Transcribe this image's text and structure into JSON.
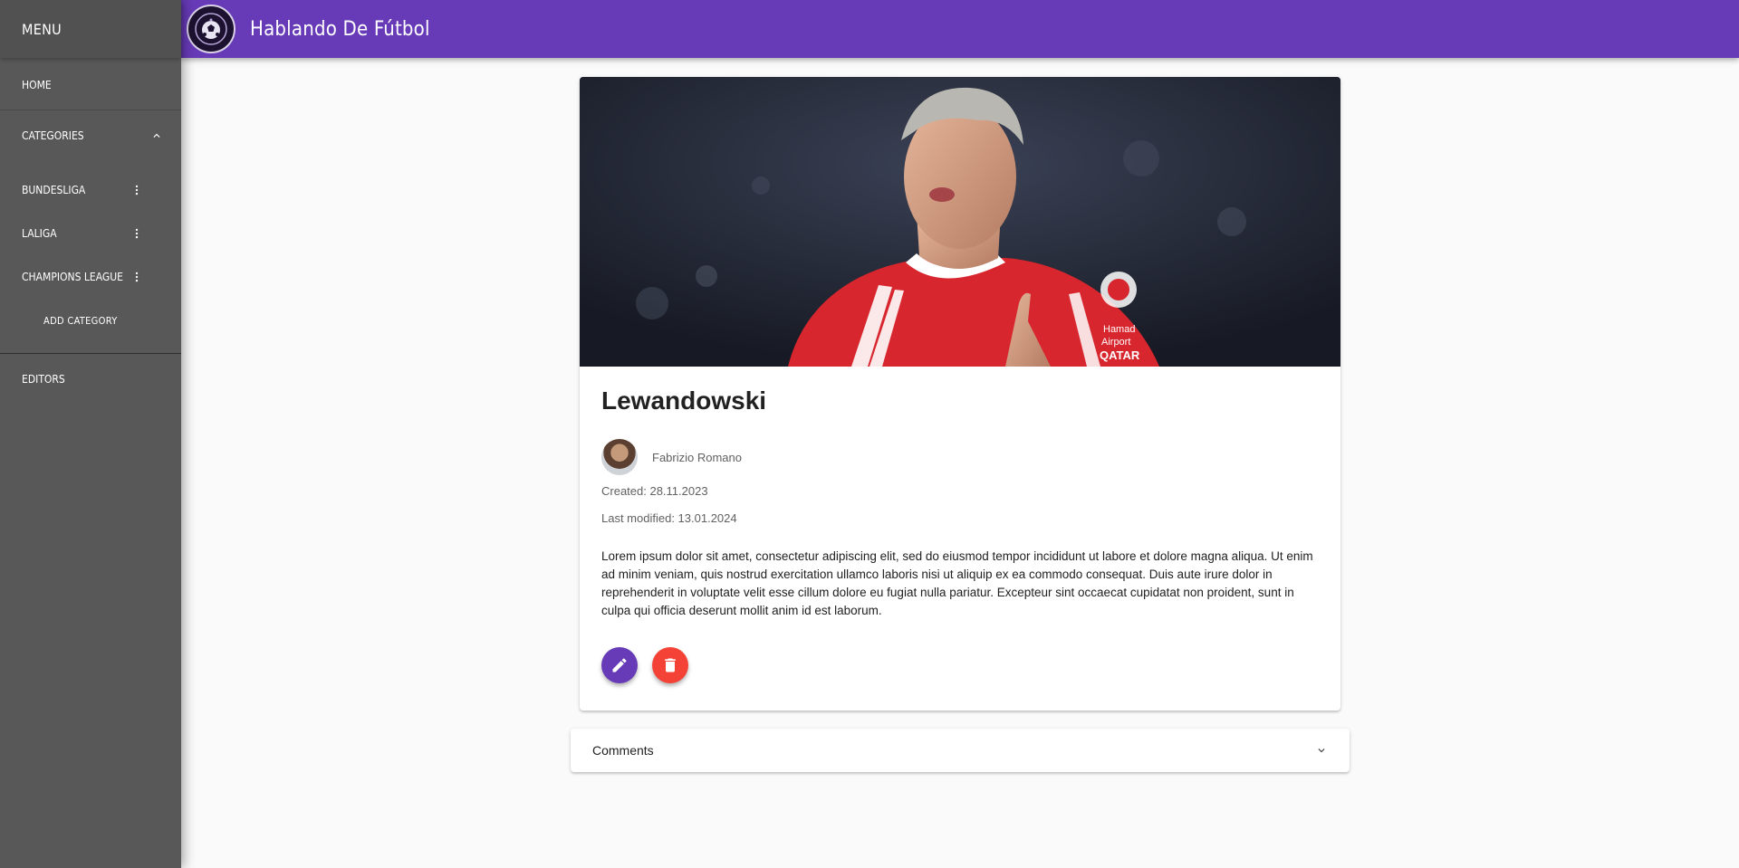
{
  "sidebar": {
    "menu_label": "MENU",
    "home_label": "HOME",
    "categories_label": "CATEGORIES",
    "categories": [
      {
        "label": "BUNDESLIGA"
      },
      {
        "label": "LALIGA"
      },
      {
        "label": "CHAMPIONS LEAGUE"
      }
    ],
    "add_category_label": "ADD CATEGORY",
    "editors_label": "EDITORS"
  },
  "header": {
    "site_title": "Hablando De Fútbol"
  },
  "article": {
    "title": "Lewandowski",
    "author": "Fabrizio Romano",
    "created": "Created: 28.11.2023",
    "modified": "Last modified: 13.01.2024",
    "body": "Lorem ipsum dolor sit amet, consectetur adipiscing elit, sed do eiusmod tempor incididunt ut labore et dolore magna aliqua. Ut enim ad minim veniam, quis nostrud exercitation ullamco laboris nisi ut aliquip ex ea commodo consequat. Duis aute irure dolor in reprehenderit in voluptate velit esse cillum dolore eu fugiat nulla pariatur. Excepteur sint occaecat cupidatat non proident, sunt in culpa qui officia deserunt mollit anim id est laborum.",
    "image_caption_text": "Hamad Airport QATAR"
  },
  "comments": {
    "label": "Comments"
  },
  "colors": {
    "primary": "#673ab7",
    "danger": "#f44336",
    "sidebar": "#585858"
  },
  "icons": {
    "edit": "pencil-icon",
    "delete": "trash-icon",
    "chevron_up": "chevron-up-icon",
    "chevron_down": "chevron-down-icon",
    "kebab": "more-vert-icon"
  }
}
